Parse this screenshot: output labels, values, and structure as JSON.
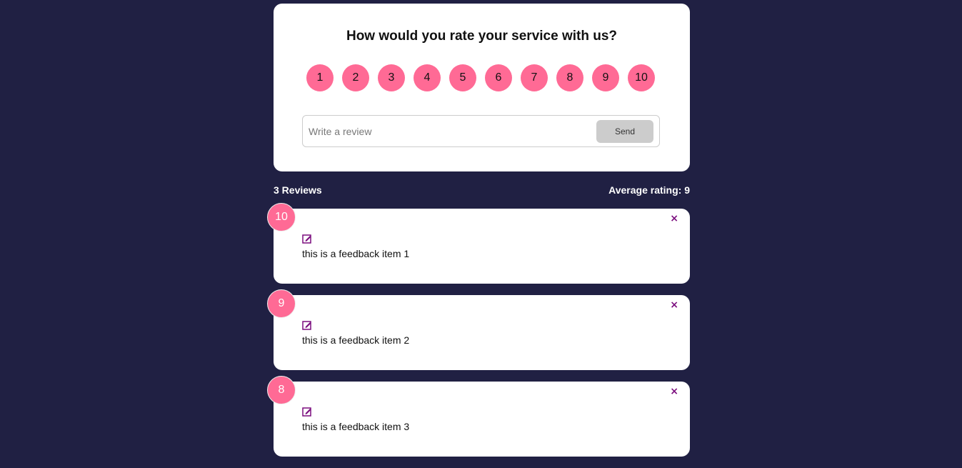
{
  "rating_card": {
    "title": "How would you rate your service with us?",
    "options": [
      "1",
      "2",
      "3",
      "4",
      "5",
      "6",
      "7",
      "8",
      "9",
      "10"
    ],
    "review_placeholder": "Write a review",
    "send_label": "Send"
  },
  "stats": {
    "reviews_label": "3 Reviews",
    "average_label": "Average rating: 9"
  },
  "feedback": [
    {
      "rating": "10",
      "text": "this is a feedback item 1",
      "close_icon": "×",
      "edit_icon": "edit-icon"
    },
    {
      "rating": "9",
      "text": "this is a feedback item 2",
      "close_icon": "×",
      "edit_icon": "edit-icon"
    },
    {
      "rating": "8",
      "text": "this is a feedback item 3",
      "close_icon": "×",
      "edit_icon": "edit-icon"
    }
  ],
  "colors": {
    "background": "#202043",
    "accent": "#ff6a95",
    "icon": "#7b0d7e"
  }
}
